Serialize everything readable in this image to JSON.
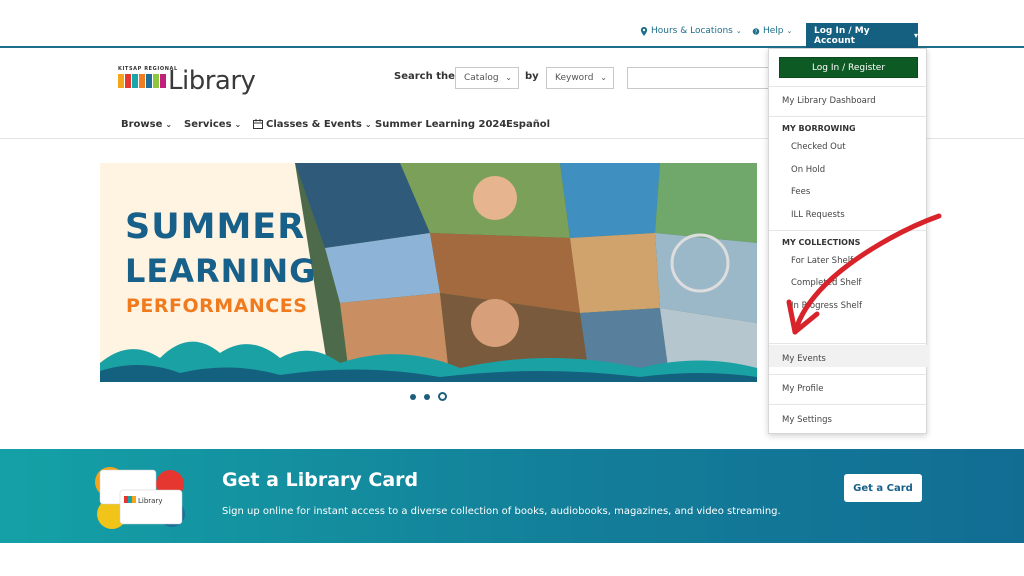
{
  "utility": {
    "hours_label": "Hours & Locations",
    "help_label": "Help",
    "account_label": "Log In / My Account"
  },
  "logo": {
    "small": "KITSAP REGIONAL",
    "word": "Library"
  },
  "search": {
    "label": "Search the",
    "scope": "Catalog",
    "by_label": "by",
    "field": "Keyword",
    "input_value": ""
  },
  "nav": {
    "items": [
      "Browse",
      "Services",
      "Classes & Events",
      "Summer Learning 2024",
      "Español"
    ]
  },
  "hero": {
    "line1": "SUMMER",
    "line2": "LEARNING",
    "line3": "PERFORMANCES",
    "slide_count": 3,
    "active_slide": 3
  },
  "card_band": {
    "title": "Get a Library Card",
    "subtitle": "Sign up online for instant access to a diverse collection of books, audiobooks, magazines, and video streaming.",
    "button": "Get a Card",
    "card_text": "Library"
  },
  "dropdown": {
    "login": "Log In / Register",
    "dashboard": "My Library Dashboard",
    "borrowing_heading": "MY BORROWING",
    "borrowing": [
      "Checked Out",
      "On Hold",
      "Fees",
      "ILL Requests"
    ],
    "collections_heading": "MY COLLECTIONS",
    "collections": [
      "For Later Shelf",
      "Completed Shelf",
      "In Progress Shelf"
    ],
    "events": "My Events",
    "profile": "My Profile",
    "settings": "My Settings"
  },
  "colors": {
    "brand_teal": "#155f80",
    "login_green": "#0d5a24",
    "hero_blue": "#17608a",
    "hero_orange": "#f07b1f",
    "annotation_red": "#d8232a"
  }
}
